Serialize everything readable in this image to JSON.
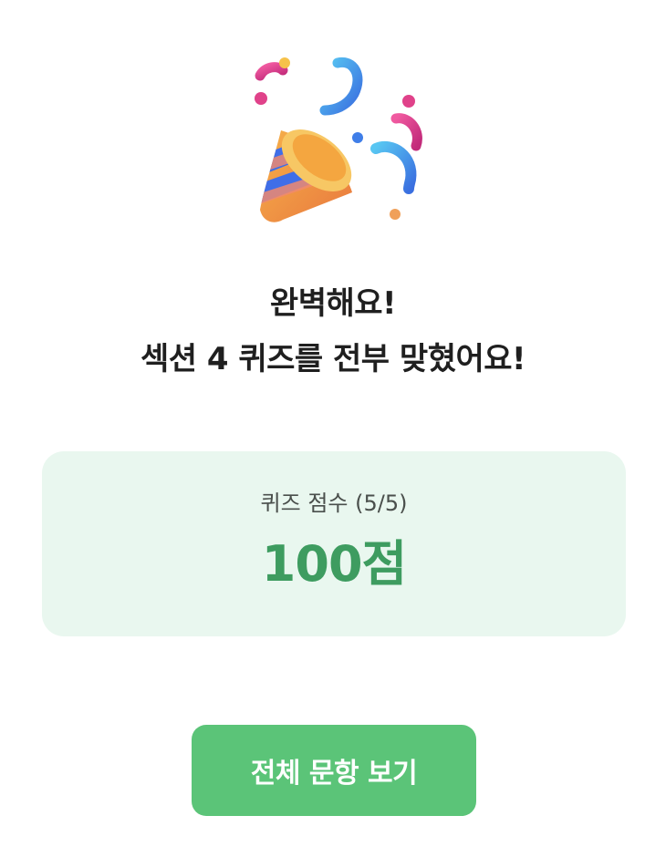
{
  "illustration": {
    "icon": "party-popper-icon"
  },
  "result": {
    "title_line1": "완벽해요!",
    "title_line2": "섹션 4 퀴즈를 전부 맞혔어요!"
  },
  "score_card": {
    "label": "퀴즈 점수 (5/5)",
    "value": "100점",
    "background_color": "#e9f7ef",
    "value_color": "#3e9c60"
  },
  "actions": {
    "view_all_label": "전체 문항 보기",
    "button_color": "#5bc478"
  }
}
